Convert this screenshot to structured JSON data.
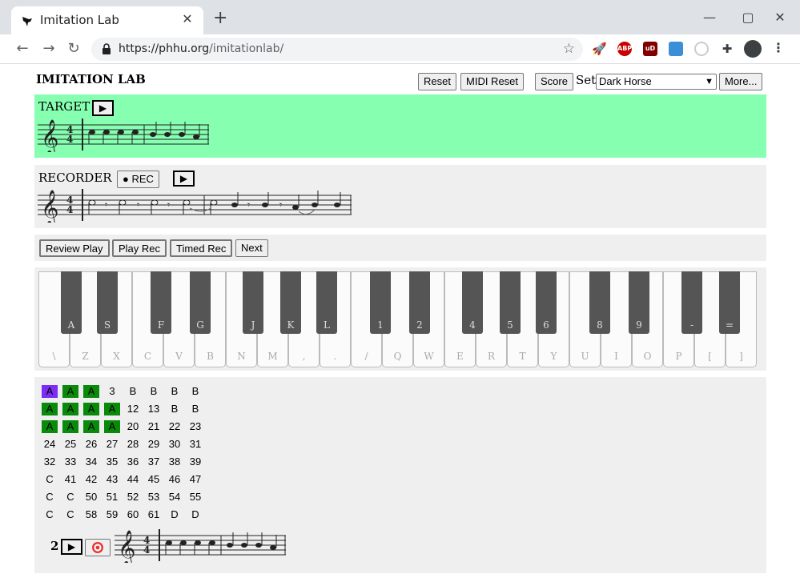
{
  "browser": {
    "tab_title": "Imitation Lab",
    "url_host": "https://phhu.org",
    "url_path": "/imitationlab/",
    "extensions": [
      {
        "name": "rocket-icon",
        "label": ""
      },
      {
        "name": "adblock-plus-icon",
        "label": "ABP",
        "color": "#c80000"
      },
      {
        "name": "ublock-icon",
        "label": "uD",
        "color": "#800000"
      },
      {
        "name": "image-extension-icon",
        "label": ""
      },
      {
        "name": "circle-extension-icon",
        "label": ""
      },
      {
        "name": "puzzle-icon",
        "label": ""
      },
      {
        "name": "profile-icon",
        "label": ""
      },
      {
        "name": "kebab-menu-icon",
        "label": ""
      }
    ]
  },
  "header": {
    "title": "IMITATION LAB",
    "reset": "Reset",
    "midi_reset": "MIDI Reset",
    "score": "Score",
    "set_label": "Set:",
    "set_value": "Dark Horse",
    "more": "More..."
  },
  "target": {
    "label": "TARGET",
    "play": "▶"
  },
  "recorder": {
    "label": "RECORDER",
    "rec": "● REC",
    "play": "▶"
  },
  "controls": {
    "review_play": "Review Play",
    "play_rec": "Play Rec",
    "timed_rec": "Timed Rec",
    "next": "Next"
  },
  "keyboard": {
    "white_keys": [
      "\\",
      "Z",
      "X",
      "C",
      "V",
      "B",
      "N",
      "M",
      ",",
      ".",
      "/",
      "Q",
      "W",
      "E",
      "R",
      "T",
      "Y",
      "U",
      "I",
      "O",
      "P",
      "[",
      "]"
    ],
    "black_keys": [
      "A",
      "S",
      "F",
      "G",
      "J",
      "K",
      "L",
      "1",
      "2",
      "4",
      "5",
      "6",
      "8",
      "9",
      "-",
      "="
    ]
  },
  "grid": {
    "rows": [
      [
        "A",
        "A",
        "A",
        "3",
        "B",
        "B",
        "B",
        "B"
      ],
      [
        "A",
        "A",
        "A",
        "A",
        "12",
        "13",
        "B",
        "B"
      ],
      [
        "A",
        "A",
        "A",
        "A",
        "20",
        "21",
        "22",
        "23"
      ],
      [
        "24",
        "25",
        "26",
        "27",
        "28",
        "29",
        "30",
        "31"
      ],
      [
        "32",
        "33",
        "34",
        "35",
        "36",
        "37",
        "38",
        "39"
      ],
      [
        "C",
        "41",
        "42",
        "43",
        "44",
        "45",
        "46",
        "47"
      ],
      [
        "C",
        "C",
        "50",
        "51",
        "52",
        "53",
        "54",
        "55"
      ],
      [
        "C",
        "C",
        "58",
        "59",
        "60",
        "61",
        "D",
        "D"
      ]
    ],
    "highlights": [
      [
        "purple",
        "green",
        "green",
        "",
        "",
        "",
        "",
        ""
      ],
      [
        "green",
        "green",
        "green",
        "green",
        "",
        "",
        "",
        ""
      ],
      [
        "green",
        "green",
        "green",
        "green",
        "",
        "",
        "",
        ""
      ]
    ],
    "colors": {
      "green": "#0a8a0a",
      "purple": "#7b2cf5"
    }
  },
  "footer": {
    "index": "2",
    "play": "▶",
    "target_icon": "target-icon"
  }
}
